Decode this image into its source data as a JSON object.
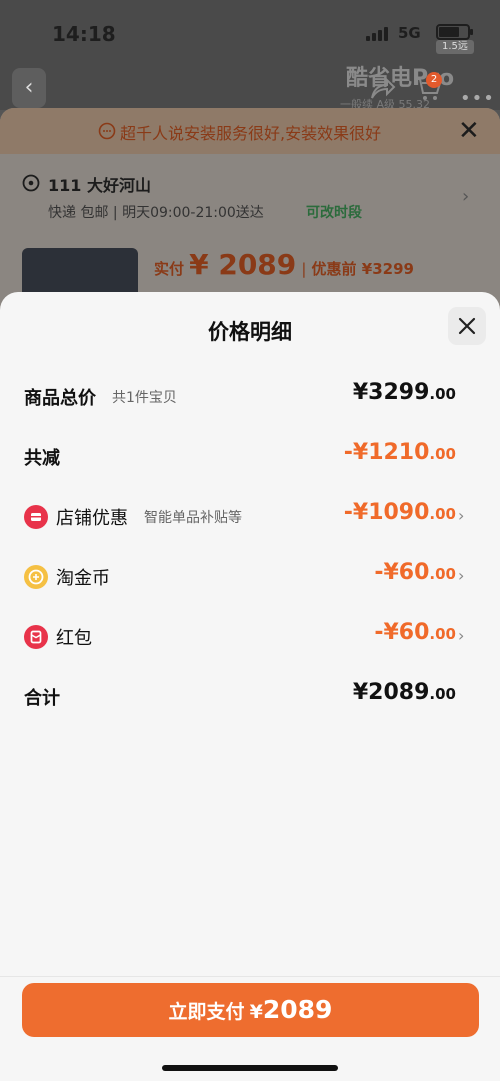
{
  "status_bar": {
    "time": "14:18",
    "network": "5G",
    "speed_badge": "1.5远"
  },
  "background": {
    "brand_title": "酷省电Pro",
    "brand_sub": "一般续 A级 55.32",
    "cart_badge": "2",
    "notice": "超千人说安装服务很好,安装效果很好",
    "address_name": "111 大好河山",
    "delivery": "快递 包邮 | 明天09:00-21:00送达",
    "delivery_alt": "可改时段",
    "pay_label": "实付",
    "pay_amount": "¥ 2089",
    "pay_sep": "|",
    "pay_before": "优惠前 ¥3299"
  },
  "sheet": {
    "title": "价格明细",
    "rows": [
      {
        "label": "商品总价",
        "sub": "共1件宝贝",
        "value_int": "¥3299",
        "value_dec": ".00"
      },
      {
        "label": "共减",
        "sub": "",
        "value_int": "-¥1210",
        "value_dec": ".00"
      },
      {
        "label": "店铺优惠",
        "sub": "智能单品补贴等",
        "value_int": "-¥1090",
        "value_dec": ".00",
        "icon": "store-coupon-icon",
        "icon_color": "#e8334a"
      },
      {
        "label": "淘金币",
        "sub": "",
        "value_int": "-¥60",
        "value_dec": ".00",
        "icon": "gold-coin-icon",
        "icon_color": "#f5c043"
      },
      {
        "label": "红包",
        "sub": "",
        "value_int": "-¥60",
        "value_dec": ".00",
        "icon": "red-packet-icon",
        "icon_color": "#e8334a"
      },
      {
        "label": "合计",
        "sub": "",
        "value_int": "¥2089",
        "value_dec": ".00"
      }
    ]
  },
  "pay_button": {
    "label": "立即支付",
    "amount_prefix": "¥",
    "amount": "2089"
  },
  "colors": {
    "accent": "#ee6d2f",
    "discount": "#f06a2a"
  }
}
